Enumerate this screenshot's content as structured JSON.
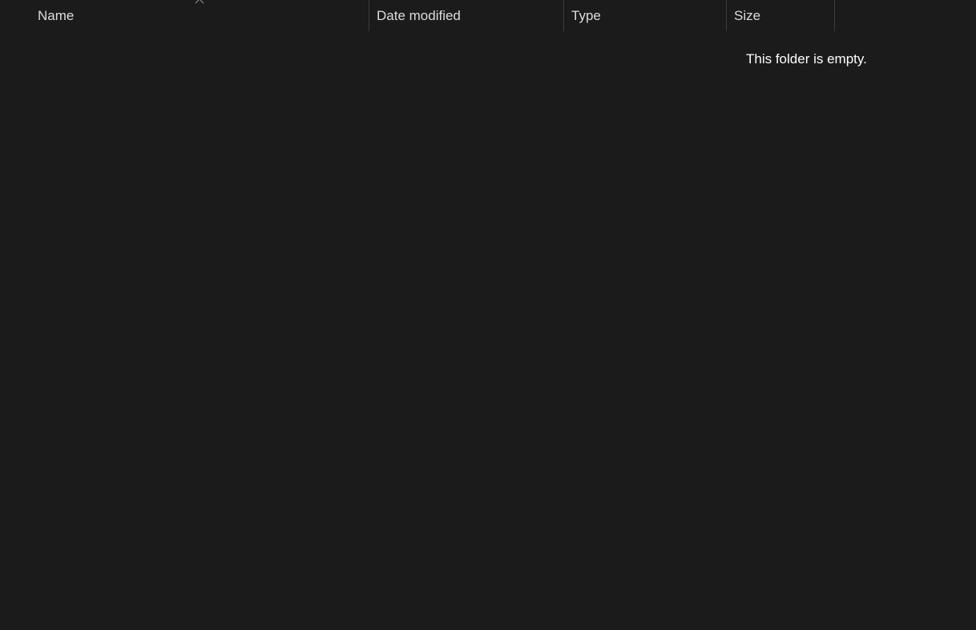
{
  "columns": {
    "name": "Name",
    "date_modified": "Date modified",
    "type": "Type",
    "size": "Size"
  },
  "sort": {
    "column": "Name",
    "direction": "ascending",
    "icon": "chevron-up-icon"
  },
  "content": {
    "empty_message": "This folder is empty."
  },
  "colors": {
    "background": "#1b1b1b",
    "header_text": "#dcdcdc",
    "divider": "#3d3d3d",
    "text": "#ffffff"
  }
}
